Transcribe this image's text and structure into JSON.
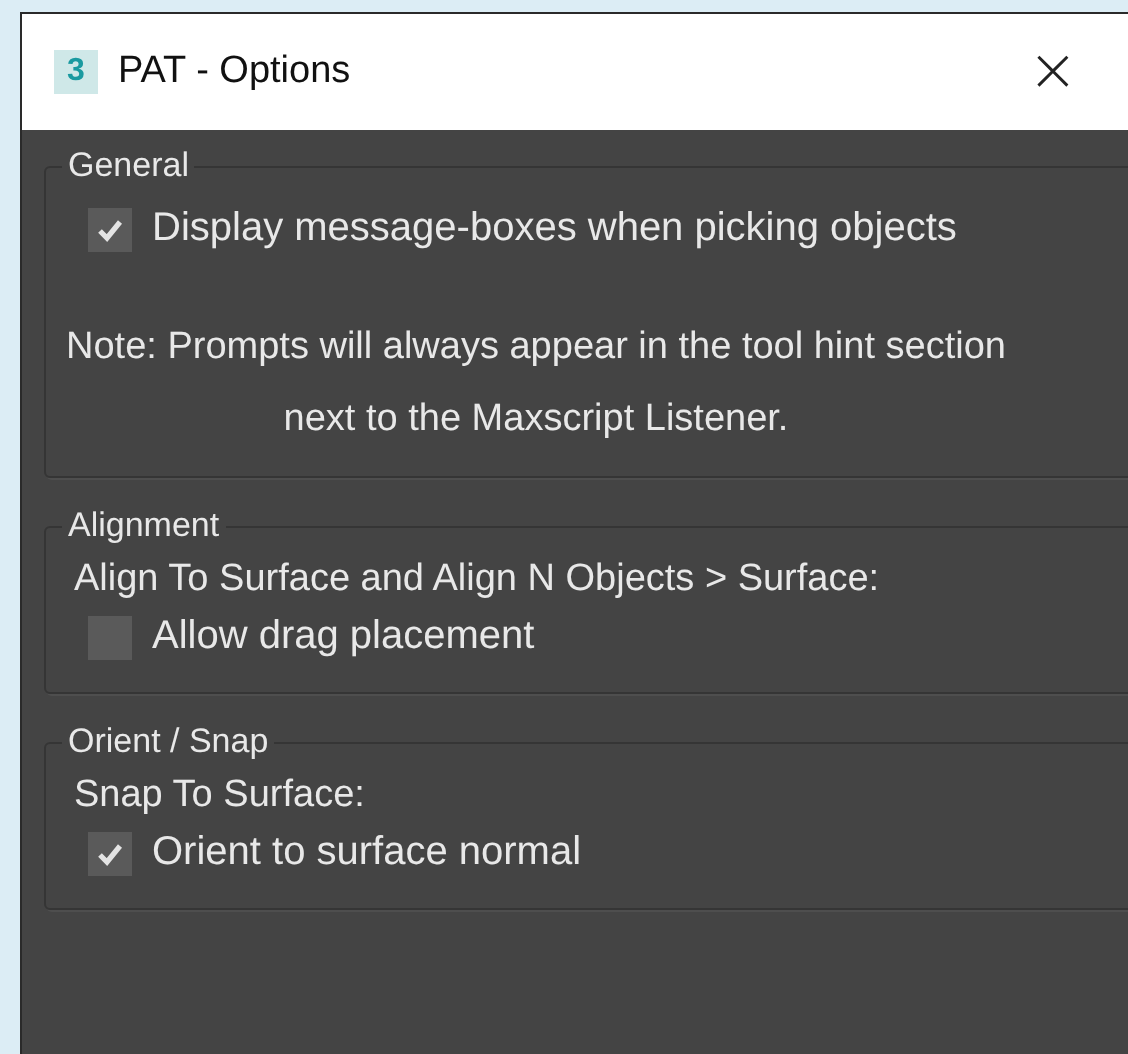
{
  "window": {
    "title": "PAT - Options",
    "icon_text": "3",
    "close": "×"
  },
  "groups": [
    {
      "legend": "General",
      "items": [
        {
          "kind": "checkbox",
          "label": "Display message-boxes when picking objects",
          "checked": true
        },
        {
          "kind": "note",
          "text": "Note: Prompts will always appear in the tool hint section next to the Maxscript Listener."
        }
      ]
    },
    {
      "legend": "Alignment",
      "items": [
        {
          "kind": "text",
          "text": "Align To Surface and Align N Objects > Surface:"
        },
        {
          "kind": "checkbox",
          "label": "Allow drag placement",
          "checked": false
        }
      ]
    },
    {
      "legend": "Orient / Snap",
      "items": [
        {
          "kind": "text",
          "text": "Snap To Surface:"
        },
        {
          "kind": "checkbox",
          "label": "Orient to surface normal",
          "checked": true
        }
      ]
    }
  ]
}
